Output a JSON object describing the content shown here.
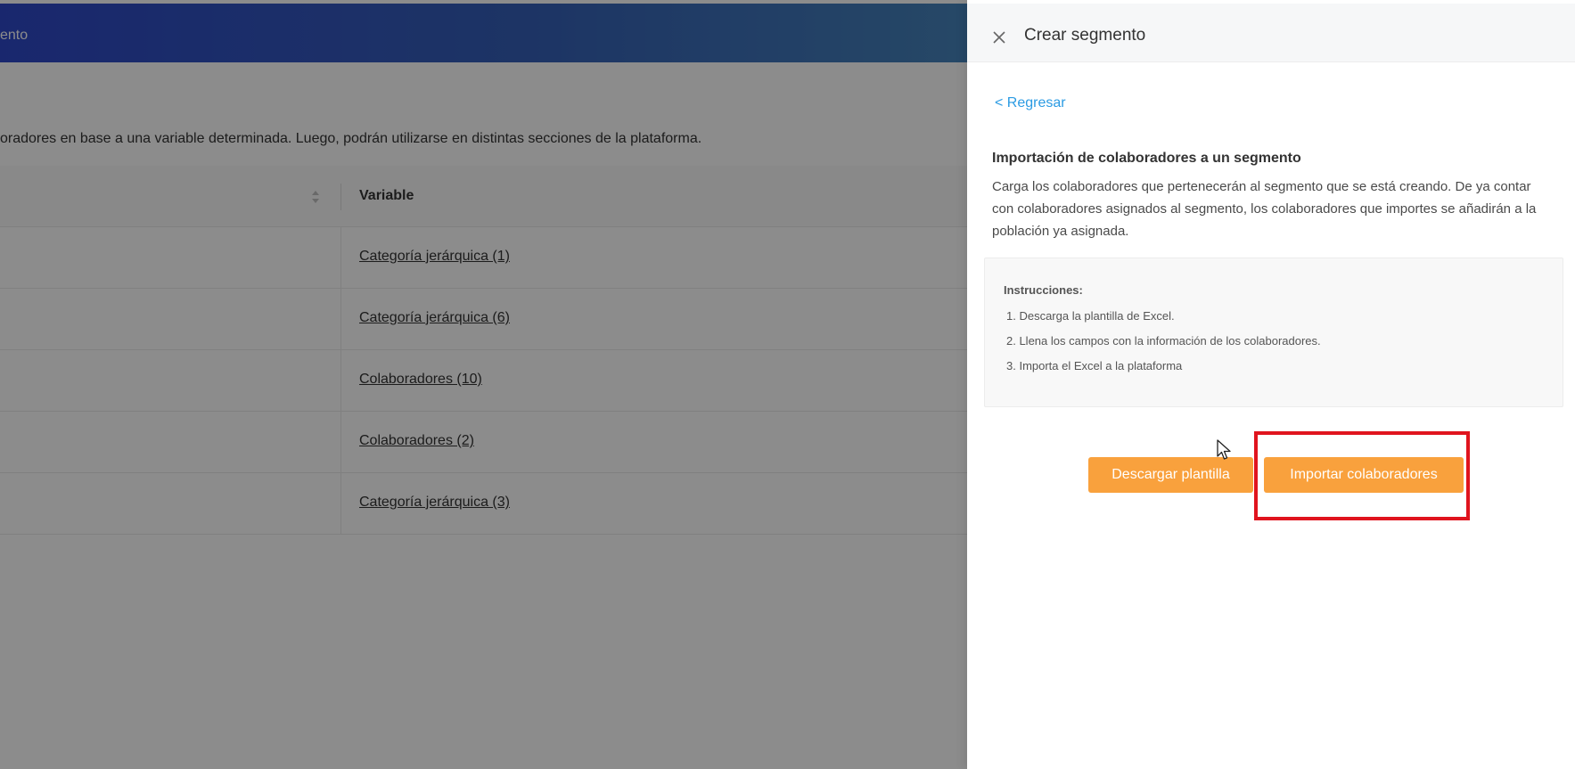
{
  "background": {
    "header_title": "ento",
    "description": "oradores en base a una variable determinada. Luego, podrán utilizarse en distintas secciones de la plataforma.",
    "table": {
      "column_variable": "Variable",
      "rows": [
        {
          "variable": "Categoría jerárquica (1)"
        },
        {
          "variable": "Categoría jerárquica (6)"
        },
        {
          "variable": "Colaboradores (10)"
        },
        {
          "variable": "Colaboradores (2)"
        },
        {
          "variable": "Categoría jerárquica (3)"
        }
      ]
    }
  },
  "drawer": {
    "title": "Crear segmento",
    "back_label": "< Regresar",
    "section_title": "Importación de colaboradores a un segmento",
    "section_description": "Carga los colaboradores que pertenecerán al segmento que se está creando. De ya contar con colaboradores asignados al segmento, los colaboradores que importes se añadirán a la población ya asignada.",
    "instructions": {
      "title": "Instrucciones:",
      "items": [
        "1. Descarga la plantilla de Excel.",
        "2. Llena los campos con la información de los colaboradores.",
        "3. Importa el Excel a la plataforma"
      ]
    },
    "buttons": {
      "download_label": "Descargar plantilla",
      "import_label": "Importar colaboradores"
    }
  },
  "colors": {
    "header_gradient_start": "#2f48c8",
    "header_gradient_end": "#4684bc",
    "button_orange": "#f9a13d",
    "link_blue": "#2b9be3",
    "highlight_red": "#e0141e"
  },
  "icons": {
    "close": "close-icon",
    "sort": "sort-icon",
    "cursor": "cursor-icon"
  }
}
